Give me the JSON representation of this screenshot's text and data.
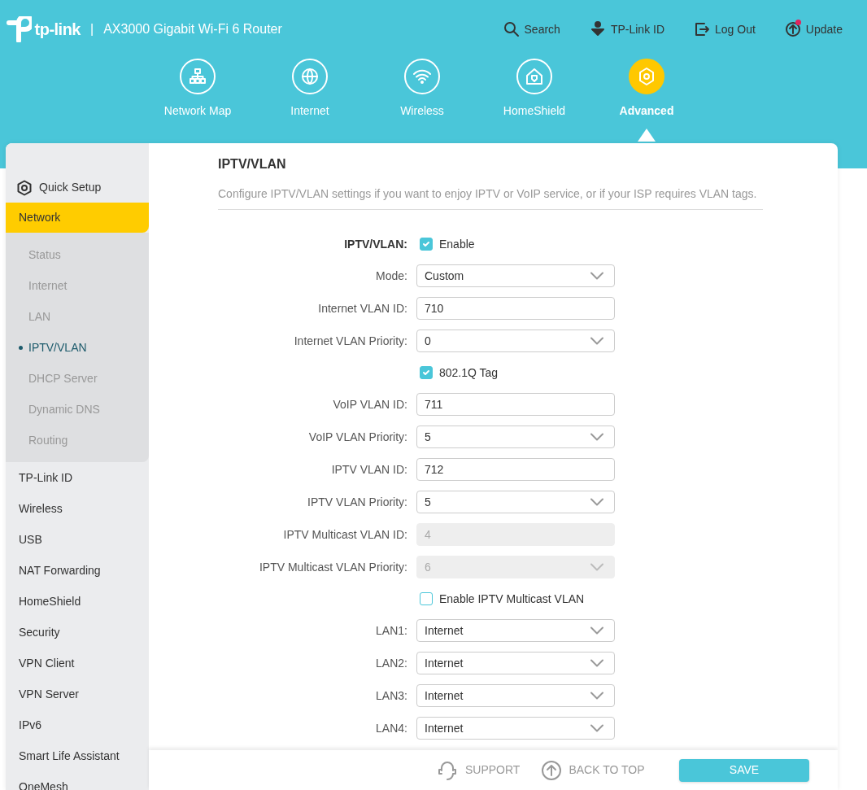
{
  "header": {
    "brand": "tp-link",
    "separator": "|",
    "product": "AX3000 Gigabit Wi-Fi 6 Router",
    "top_links": [
      {
        "label": "Search",
        "notification": false
      },
      {
        "label": "TP-Link ID",
        "notification": false
      },
      {
        "label": "Log Out",
        "notification": false
      },
      {
        "label": "Update",
        "notification": true
      }
    ],
    "tabs": [
      {
        "label": "Network Map",
        "selected": false
      },
      {
        "label": "Internet",
        "selected": false
      },
      {
        "label": "Wireless",
        "selected": false
      },
      {
        "label": "HomeShield",
        "selected": false
      },
      {
        "label": "Advanced",
        "selected": true
      }
    ]
  },
  "sidebar": {
    "quick_setup": "Quick Setup",
    "items": [
      {
        "label": "Network",
        "selected": true,
        "children": [
          {
            "label": "Status",
            "selected": false
          },
          {
            "label": "Internet",
            "selected": false
          },
          {
            "label": "LAN",
            "selected": false
          },
          {
            "label": "IPTV/VLAN",
            "selected": true
          },
          {
            "label": "DHCP Server",
            "selected": false
          },
          {
            "label": "Dynamic DNS",
            "selected": false
          },
          {
            "label": "Routing",
            "selected": false
          }
        ]
      },
      {
        "label": "TP-Link ID",
        "selected": false
      },
      {
        "label": "Wireless",
        "selected": false
      },
      {
        "label": "USB",
        "selected": false
      },
      {
        "label": "NAT Forwarding",
        "selected": false
      },
      {
        "label": "HomeShield",
        "selected": false
      },
      {
        "label": "Security",
        "selected": false
      },
      {
        "label": "VPN Client",
        "selected": false
      },
      {
        "label": "VPN Server",
        "selected": false
      },
      {
        "label": "IPv6",
        "selected": false
      },
      {
        "label": "Smart Life Assistant",
        "selected": false
      },
      {
        "label": "OneMesh",
        "selected": false
      }
    ]
  },
  "content": {
    "title": "IPTV/VLAN",
    "description": "Configure IPTV/VLAN settings if you want to enjoy IPTV or VoIP service, or if your ISP requires VLAN tags.",
    "fields": [
      {
        "kind": "checkbox",
        "label": "IPTV/VLAN:",
        "text": "Enable",
        "checked": true
      },
      {
        "kind": "select",
        "label": "Mode:",
        "value": "Custom",
        "disabled": false
      },
      {
        "kind": "input",
        "label": "Internet VLAN ID:",
        "value": "710",
        "disabled": false
      },
      {
        "kind": "select",
        "label": "Internet VLAN Priority:",
        "value": "0",
        "disabled": false
      },
      {
        "kind": "checkbox",
        "text": "802.1Q Tag",
        "checked": true
      },
      {
        "kind": "input",
        "label": "VoIP VLAN ID:",
        "value": "711",
        "disabled": false
      },
      {
        "kind": "select",
        "label": "VoIP VLAN Priority:",
        "value": "5",
        "disabled": false
      },
      {
        "kind": "input",
        "label": "IPTV VLAN ID:",
        "value": "712",
        "disabled": false
      },
      {
        "kind": "select",
        "label": "IPTV VLAN Priority:",
        "value": "5",
        "disabled": false
      },
      {
        "kind": "input",
        "label": "IPTV Multicast VLAN ID:",
        "value": "4",
        "disabled": true
      },
      {
        "kind": "select",
        "label": "IPTV Multicast VLAN Priority:",
        "value": "6",
        "disabled": true
      },
      {
        "kind": "checkbox",
        "text": "Enable IPTV Multicast VLAN",
        "checked": false
      },
      {
        "kind": "select",
        "label": "LAN1:",
        "value": "Internet",
        "disabled": false
      },
      {
        "kind": "select",
        "label": "LAN2:",
        "value": "Internet",
        "disabled": false
      },
      {
        "kind": "select",
        "label": "LAN3:",
        "value": "Internet",
        "disabled": false
      },
      {
        "kind": "select",
        "label": "LAN4:",
        "value": "Internet",
        "disabled": false
      }
    ]
  },
  "footer": {
    "support": "SUPPORT",
    "back_to_top": "BACK TO TOP",
    "save": "SAVE"
  }
}
